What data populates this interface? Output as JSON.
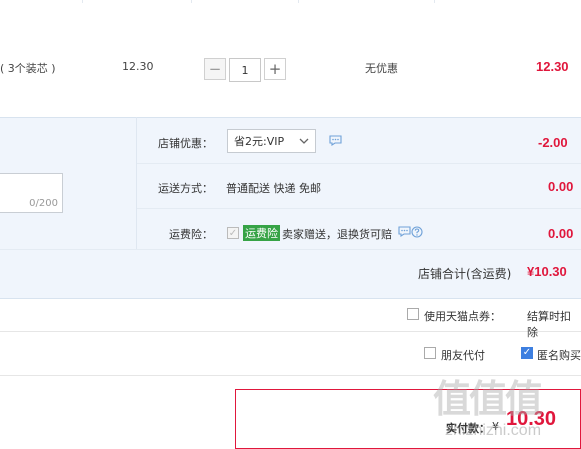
{
  "item": {
    "desc": "( 3个装芯 )",
    "unit_price": "12.30",
    "qty": "1",
    "qty_minus": "−",
    "qty_plus": "+",
    "promo": "无优惠",
    "subtotal": "12.30"
  },
  "shop": {
    "discount_label": "店铺优惠：",
    "discount_select": "省2元:VIP",
    "discount_value": "-2.00",
    "shipping_label": "运送方式：",
    "shipping_value": "普通配送 快递 免邮",
    "shipping_fee": "0.00",
    "insurance_label": "运费险：",
    "insurance_badge": "运费险",
    "insurance_text": "卖家赠送，退换货可赔",
    "insurance_fee": "0.00",
    "note_counter": "0/200",
    "total_label": "店铺合计(含运费)",
    "total_value": "¥10.30"
  },
  "points": {
    "label": "使用天猫点券：",
    "deduct_text": "结算时扣除"
  },
  "options": {
    "friend_pay": "朋友代付",
    "anonymous": "匿名购买"
  },
  "summary": {
    "pay_label": "实付款：",
    "currency": "¥",
    "amount": "10.30"
  },
  "watermark": {
    "logo": "值值值",
    "url": "zhizhizhi.com"
  },
  "colors": {
    "accent_red": "#e0173c",
    "panel_bg": "#f0f5fc",
    "insurance_green": "#36a346",
    "check_blue": "#3d7fe0"
  }
}
